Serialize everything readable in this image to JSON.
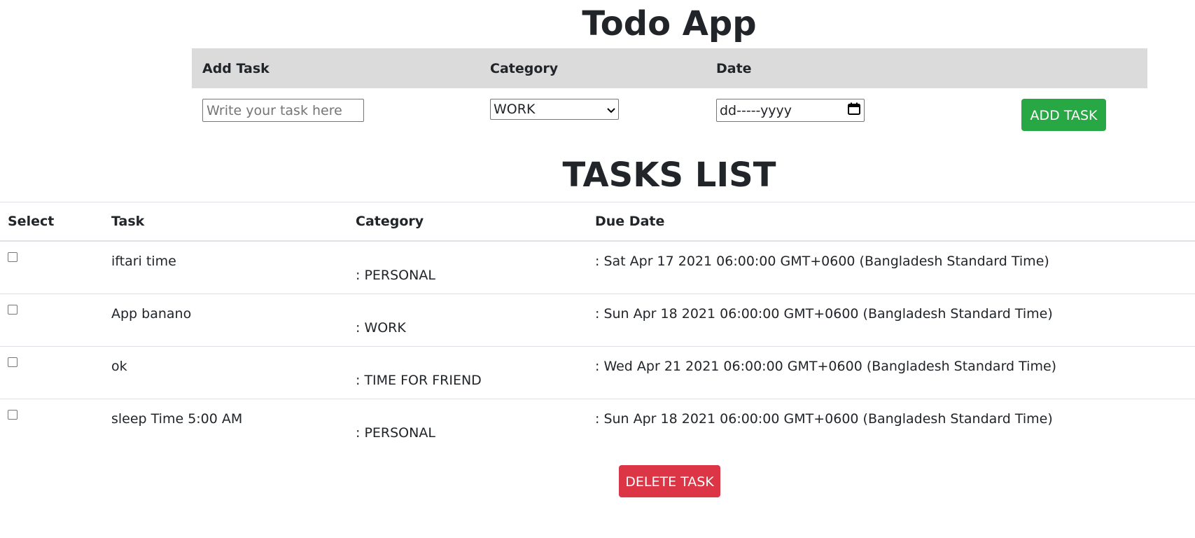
{
  "app": {
    "title": "Todo App"
  },
  "form": {
    "headers": {
      "task": "Add Task",
      "category": "Category",
      "date": "Date"
    },
    "task_placeholder": "Write your task here",
    "category_value": "WORK",
    "date_value": "dd-----yyyy",
    "add_button_label": "ADD TASK"
  },
  "list": {
    "title": "TASKS LIST",
    "headers": {
      "select": "Select",
      "task": "Task",
      "category": "Category",
      "due": "Due Date"
    },
    "rows": [
      {
        "task": "iftari time",
        "category": ": PERSONAL",
        "due": ": Sat Apr 17 2021 06:00:00 GMT+0600 (Bangladesh Standard Time)"
      },
      {
        "task": "App banano",
        "category": ": WORK",
        "due": ": Sun Apr 18 2021 06:00:00 GMT+0600 (Bangladesh Standard Time)"
      },
      {
        "task": "ok",
        "category": ": TIME FOR FRIEND",
        "due": ": Wed Apr 21 2021 06:00:00 GMT+0600 (Bangladesh Standard Time)"
      },
      {
        "task": "sleep Time 5:00 AM",
        "category": ": PERSONAL",
        "due": ": Sun Apr 18 2021 06:00:00 GMT+0600 (Bangladesh Standard Time)"
      }
    ],
    "delete_button_label": "DELETE TASK"
  },
  "icons": {
    "select_arrow": "chevron-down-icon",
    "calendar": "calendar-icon"
  },
  "colors": {
    "add": "#28a745",
    "delete": "#dc3545",
    "header_bg": "#dbdbdb"
  }
}
